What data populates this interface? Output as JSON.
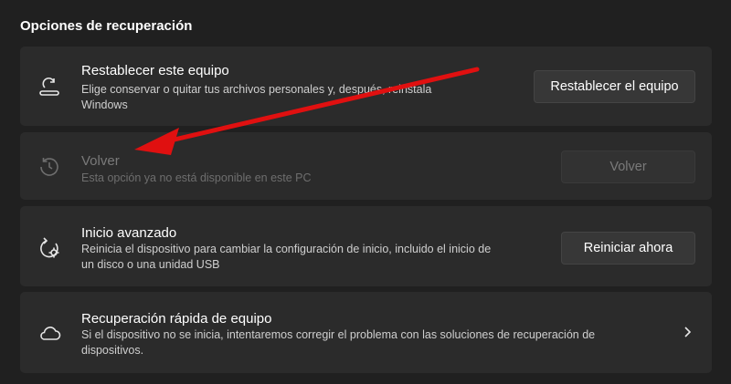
{
  "section": {
    "title": "Opciones de recuperación"
  },
  "reset": {
    "title": "Restablecer este equipo",
    "desc_line1": "Elige conservar o quitar tus archivos personales y, después, reinstala",
    "desc_line2": "Windows",
    "button": "Restablecer el equipo",
    "icon": "reset-pc-icon"
  },
  "goback": {
    "title": "Volver",
    "desc": "Esta opción ya no está disponible en este PC",
    "button": "Volver",
    "icon": "history-icon"
  },
  "advanced": {
    "title": "Inicio avanzado",
    "desc_line1": "Reinicia el dispositivo para cambiar la configuración de inicio, incluido el inicio de",
    "desc_line2": "un disco o una unidad USB",
    "button": "Reiniciar ahora",
    "icon": "advanced-startup-icon"
  },
  "quickrecovery": {
    "title": "Recuperación rápida de equipo",
    "desc_line1": "Si el dispositivo no se inicia, intentaremos corregir el problema con las soluciones de recuperación de",
    "desc_line2": "dispositivos.",
    "icon": "cloud-icon"
  },
  "colors": {
    "annotation_arrow": "#e01010"
  }
}
